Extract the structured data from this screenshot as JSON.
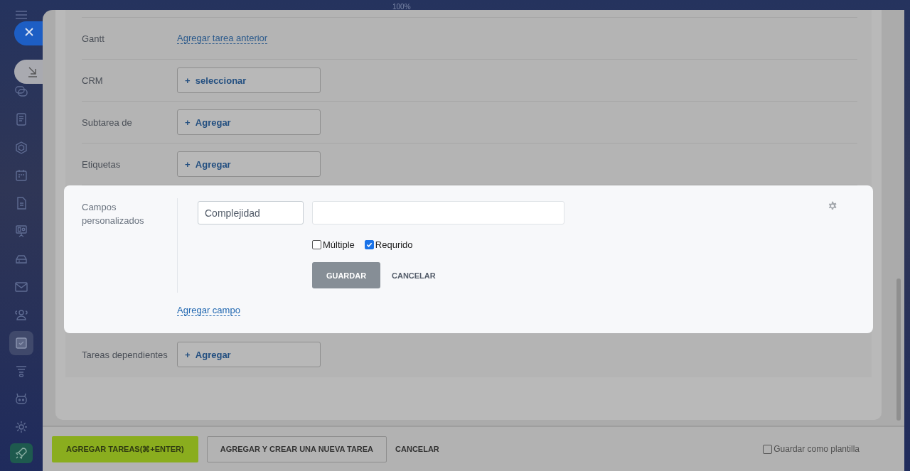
{
  "top_bar": {
    "zoom": "100%"
  },
  "sidebar": {
    "items": [
      {
        "selected": false
      },
      {
        "selected": false
      },
      {
        "selected": false
      },
      {
        "selected": false
      },
      {
        "selected": false
      },
      {
        "selected": false
      },
      {
        "selected": false
      },
      {
        "selected": false
      },
      {
        "selected": false
      },
      {
        "selected": true
      },
      {
        "selected": false
      },
      {
        "selected": false
      },
      {
        "selected": false
      }
    ]
  },
  "form": {
    "rows": [
      {
        "label": "Gantt",
        "kind": "link",
        "action": "Agregar tarea anterior"
      },
      {
        "label": "CRM",
        "kind": "button",
        "prefix": "+",
        "action": "seleccionar"
      },
      {
        "label": "Subtarea de",
        "kind": "button",
        "prefix": "+",
        "action": "Agregar"
      },
      {
        "label": "Etiquetas",
        "kind": "button",
        "prefix": "+",
        "action": "Agregar"
      }
    ],
    "custom_fields": {
      "label": "Campos personalizados",
      "name_field": {
        "value": "Complejidad"
      },
      "options": [
        {
          "label": "Múltiple",
          "checked": false
        },
        {
          "label": "Requrido",
          "checked": true
        }
      ],
      "save": "GUARDAR",
      "cancel": "CANCELAR",
      "add_link": "Agregar campo"
    },
    "rows_after": [
      {
        "label": "Tareas dependientes",
        "kind": "button",
        "prefix": "+",
        "action": "Agregar"
      }
    ]
  },
  "footer": {
    "primary": "AGREGAR TAREAS(⌘+ENTER)",
    "secondary": "AGREGAR Y CREAR UNA NUEVA TAREA",
    "cancel": "CANCELAR",
    "template": {
      "label": "Guardar como plantilla",
      "checked": false
    }
  }
}
